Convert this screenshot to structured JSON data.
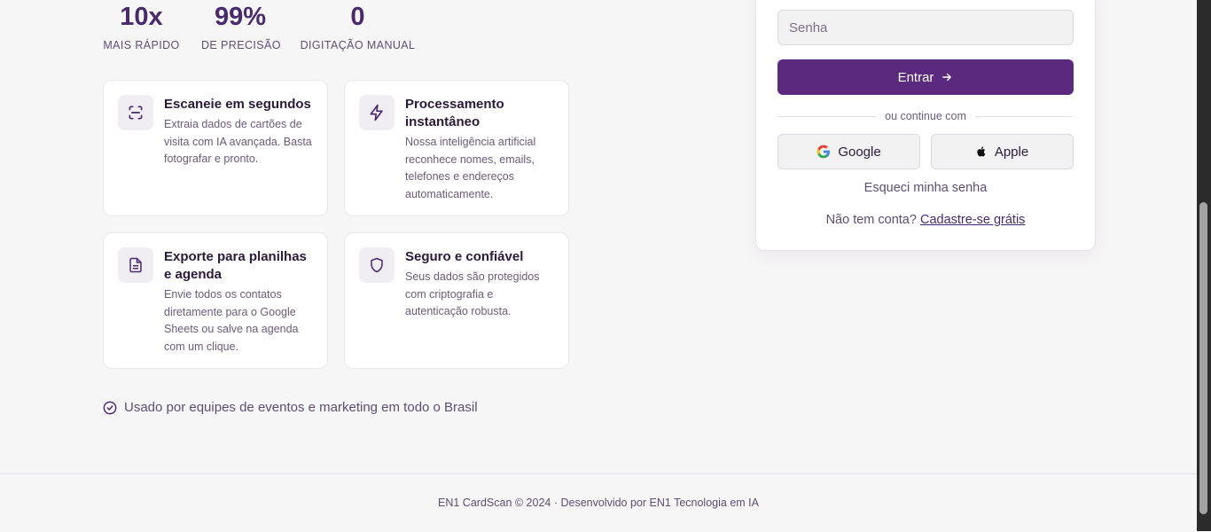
{
  "stats": [
    {
      "value": "10x",
      "label": "MAIS RÁPIDO"
    },
    {
      "value": "99%",
      "label": "DE PRECISÃO"
    },
    {
      "value": "0",
      "label": "DIGITAÇÃO MANUAL"
    }
  ],
  "features": [
    {
      "title": "Escaneie em segundos",
      "desc": "Extraia dados de cartões de visita com IA avançada. Basta fotografar e pronto.",
      "icon": "scan-icon"
    },
    {
      "title": "Processamento instantâneo",
      "desc": "Nossa inteligência artificial reconhece nomes, emails, telefones e endereços automaticamente.",
      "icon": "lightning-icon"
    },
    {
      "title": "Exporte para planilhas e agenda",
      "desc": "Envie todos os contatos diretamente para o Google Sheets ou salve na agenda com um clique.",
      "icon": "spreadsheet-icon"
    },
    {
      "title": "Seguro e confiável",
      "desc": "Seus dados são protegidos com criptografia e autenticação robusta.",
      "icon": "shield-icon"
    }
  ],
  "trust": {
    "text": "Usado por equipes de eventos e marketing em todo o Brasil",
    "icon": "check-circle-icon"
  },
  "login": {
    "password_placeholder": "Senha",
    "submit_label": "Entrar",
    "divider_text": "ou continue com",
    "google_label": "Google",
    "apple_label": "Apple",
    "forgot_label": "Esqueci minha senha",
    "signup_prompt": "Não tem conta?",
    "signup_link": "Cadastre-se grátis"
  },
  "footer": {
    "text": "EN1 CardScan © 2024 · Desenvolvido por EN1 Tecnologia em IA"
  },
  "colors": {
    "accent": "#5b2a7f",
    "heading": "#4a2a6e",
    "background": "#f7f6f6"
  }
}
